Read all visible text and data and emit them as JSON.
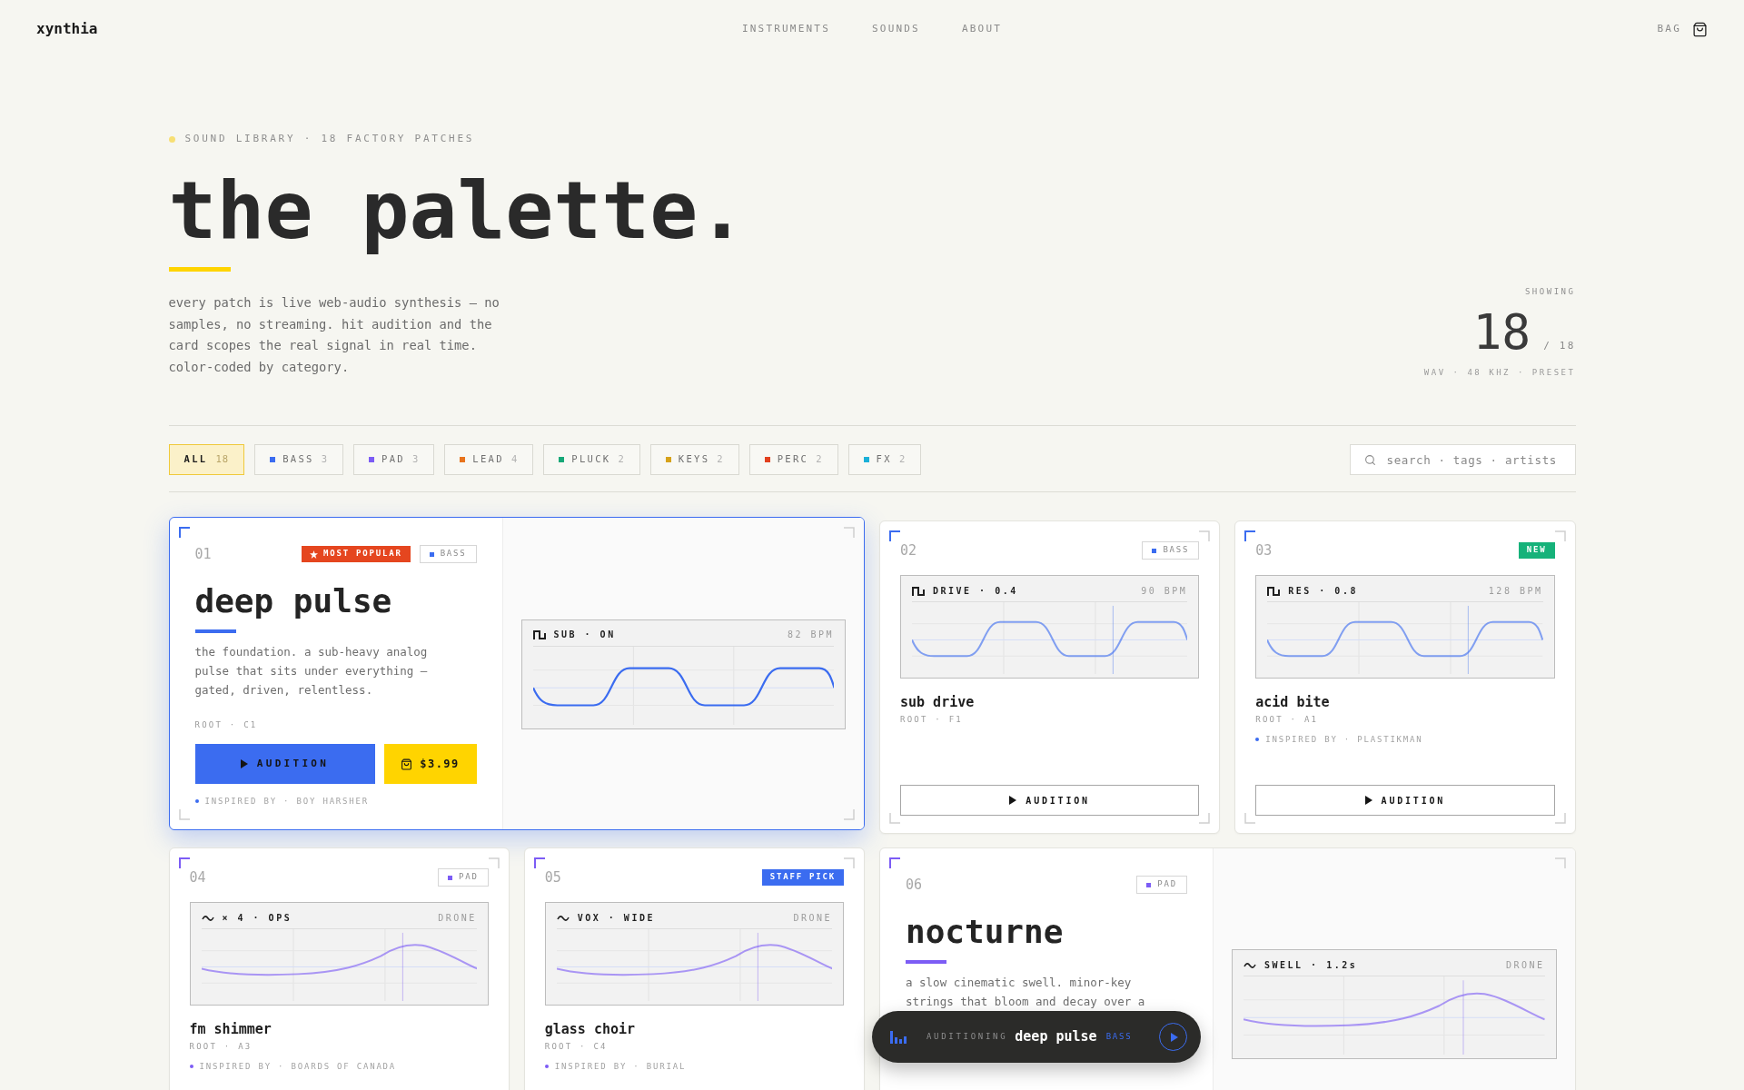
{
  "nav": {
    "logo": "xynthia",
    "links": [
      "INSTRUMENTS",
      "SOUNDS",
      "ABOUT"
    ],
    "bag": "BAG"
  },
  "hero": {
    "eyebrow": "SOUND LIBRARY · 18 FACTORY PATCHES",
    "title": "the palette.",
    "intro": "every patch is live web-audio synthesis — no samples, no streaming. hit audition and the card scopes the real signal in real time. color-coded by category.",
    "showing": {
      "label": "SHOWING",
      "count": "18",
      "total": "/ 18",
      "format": "WAV · 48 KHZ · PRESET"
    }
  },
  "filters": [
    {
      "label": "ALL",
      "count": "18",
      "selected": true
    },
    {
      "label": "BASS",
      "count": "3",
      "color": "#3b6cf0",
      "selected": false
    },
    {
      "label": "PAD",
      "count": "3",
      "color": "#7c5cf5",
      "selected": false
    },
    {
      "label": "LEAD",
      "count": "4",
      "color": "#e8731c",
      "selected": false
    },
    {
      "label": "PLUCK",
      "count": "2",
      "color": "#16a878",
      "selected": false
    },
    {
      "label": "KEYS",
      "count": "2",
      "color": "#d6a21a",
      "selected": false
    },
    {
      "label": "PERC",
      "count": "2",
      "color": "#e2401e",
      "selected": false
    },
    {
      "label": "FX",
      "count": "2",
      "color": "#1ab0d8",
      "selected": false
    }
  ],
  "search": {
    "placeholder": "search · tags · artists"
  },
  "cards": [
    {
      "kind": "featured",
      "active": true,
      "color": "#3b6cf0",
      "number": "01",
      "badge": {
        "kind": "popular",
        "label": "MOST POPULAR",
        "color": "#e5461f"
      },
      "tag": "BASS",
      "title": "deep pulse",
      "description": "the foundation. a sub-heavy analog pulse that sits under everything — gated, driven, relentless.",
      "root": "ROOT · C1",
      "audition": "AUDITION",
      "price": "$3.99",
      "inspired": "INSPIRED BY · BOY HARSHER",
      "scope": {
        "kind": "pulse",
        "label": "SUB · ON",
        "reading": "82 BPM"
      }
    },
    {
      "kind": "compact",
      "active": false,
      "color": "#3b6cf0",
      "number": "02",
      "tag": "BASS",
      "scope": {
        "kind": "pulse",
        "label": "DRIVE · 0.4",
        "reading": "90 BPM"
      },
      "title": "sub drive",
      "root": "ROOT · F1",
      "audition": "AUDITION"
    },
    {
      "kind": "compact",
      "active": false,
      "color": "#3b6cf0",
      "number": "03",
      "badge": {
        "kind": "new",
        "label": "NEW",
        "color": "#16b27a"
      },
      "scope": {
        "kind": "pulse",
        "label": "RES · 0.8",
        "reading": "128 BPM"
      },
      "title": "acid bite",
      "root": "ROOT · A1",
      "inspired": "INSPIRED BY · PLASTIKMAN",
      "audition": "AUDITION"
    },
    {
      "kind": "compact",
      "active": false,
      "color": "#7c5cf5",
      "number": "04",
      "tag": "PAD",
      "scope": {
        "kind": "swell",
        "label": "× 4 · OPS",
        "reading": "DRONE"
      },
      "title": "fm shimmer",
      "root": "ROOT · A3",
      "inspired": "INSPIRED BY · BOARDS OF CANADA"
    },
    {
      "kind": "compact",
      "active": false,
      "color": "#7c5cf5",
      "number": "05",
      "badge": {
        "kind": "pick",
        "label": "STAFF PICK",
        "color": "#3b6cf0"
      },
      "scope": {
        "kind": "swell",
        "label": "VOX · WIDE",
        "reading": "DRONE"
      },
      "title": "glass choir",
      "root": "ROOT · C4",
      "inspired": "INSPIRED BY · BURIAL"
    },
    {
      "kind": "featured",
      "active": false,
      "color": "#7c5cf5",
      "number": "06",
      "tag": "PAD",
      "title": "nocturne",
      "description": "a slow cinematic swell. minor-key strings that bloom and decay over a",
      "scope": {
        "kind": "swell",
        "label": "SWELL · 1.2s",
        "reading": "DRONE"
      }
    }
  ],
  "player": {
    "status": "AUDITIONING",
    "title": "deep pulse",
    "tag": "BASS"
  }
}
